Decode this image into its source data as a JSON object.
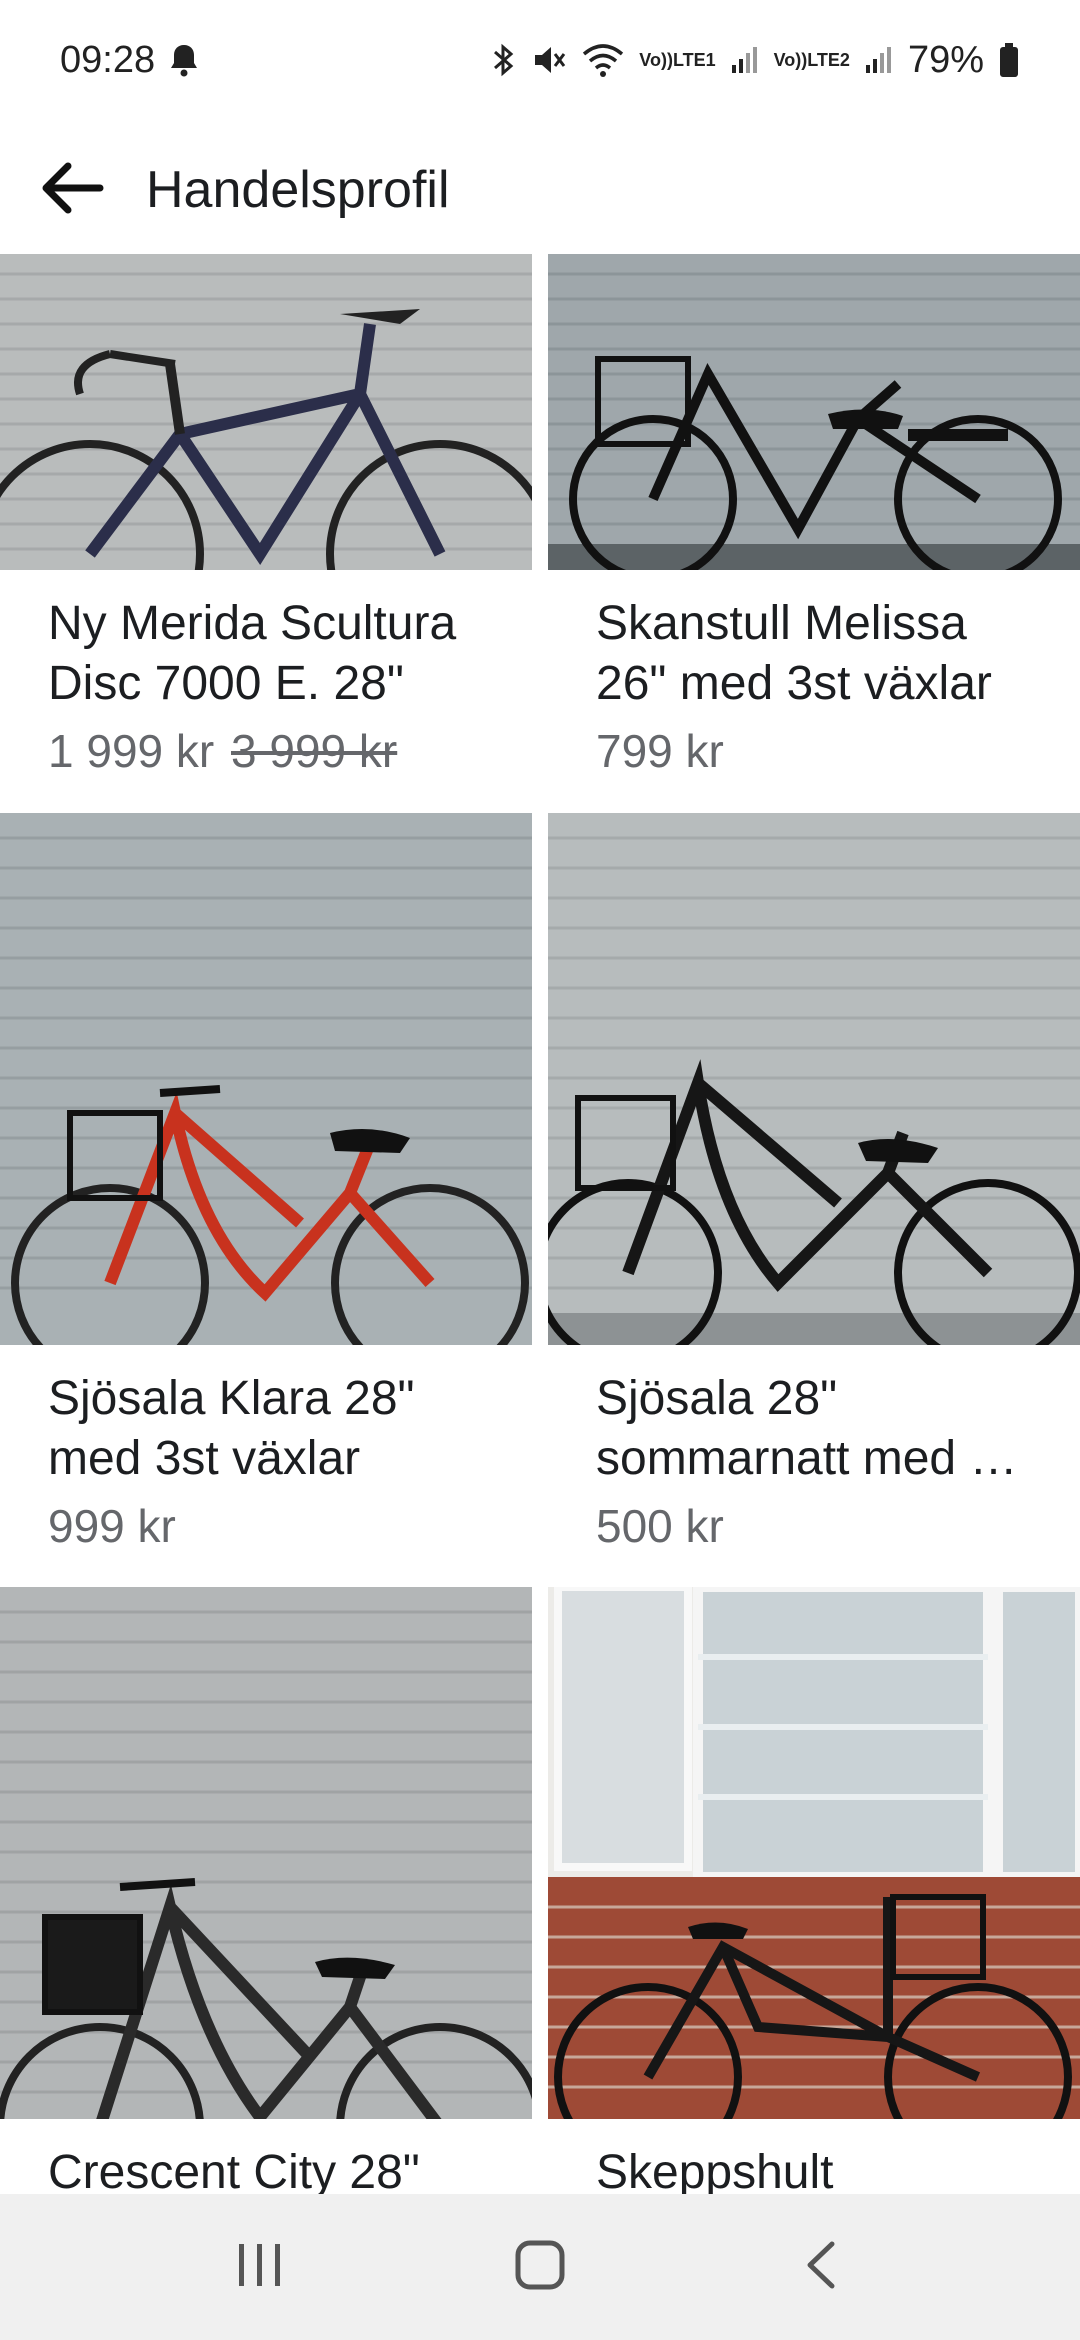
{
  "status_bar": {
    "time": "09:28",
    "battery": "79%",
    "sim1": "LTE1",
    "sim2": "LTE2",
    "volte": "Vo))",
    "icons": [
      "bell-icon",
      "bluetooth-icon",
      "mute-icon",
      "wifi-icon",
      "signal-icon",
      "battery-icon"
    ]
  },
  "header": {
    "title": "Handelsprofil",
    "back_icon": "arrow-left-icon"
  },
  "listings": [
    {
      "title": "Ny Merida Scultura Disc 7000 E.  28\"",
      "price": "1 999 kr",
      "old_price": "3 999 kr"
    },
    {
      "title": "Skanstull Melissa 26\" med 3st växlar",
      "price": "799 kr",
      "old_price": ""
    },
    {
      "title": "Sjösala Klara 28\" med 3st växlar",
      "price": "999 kr",
      "old_price": ""
    },
    {
      "title": "Sjösala 28\" sommarnatt med …",
      "price": "500 kr",
      "old_price": ""
    },
    {
      "title": "Crescent City 28\"",
      "price": "",
      "old_price": ""
    },
    {
      "title": "Skeppshult",
      "price": "",
      "old_price": ""
    }
  ],
  "nav_bar": {
    "icons": [
      "recent-apps-icon",
      "home-icon",
      "back-icon"
    ]
  }
}
